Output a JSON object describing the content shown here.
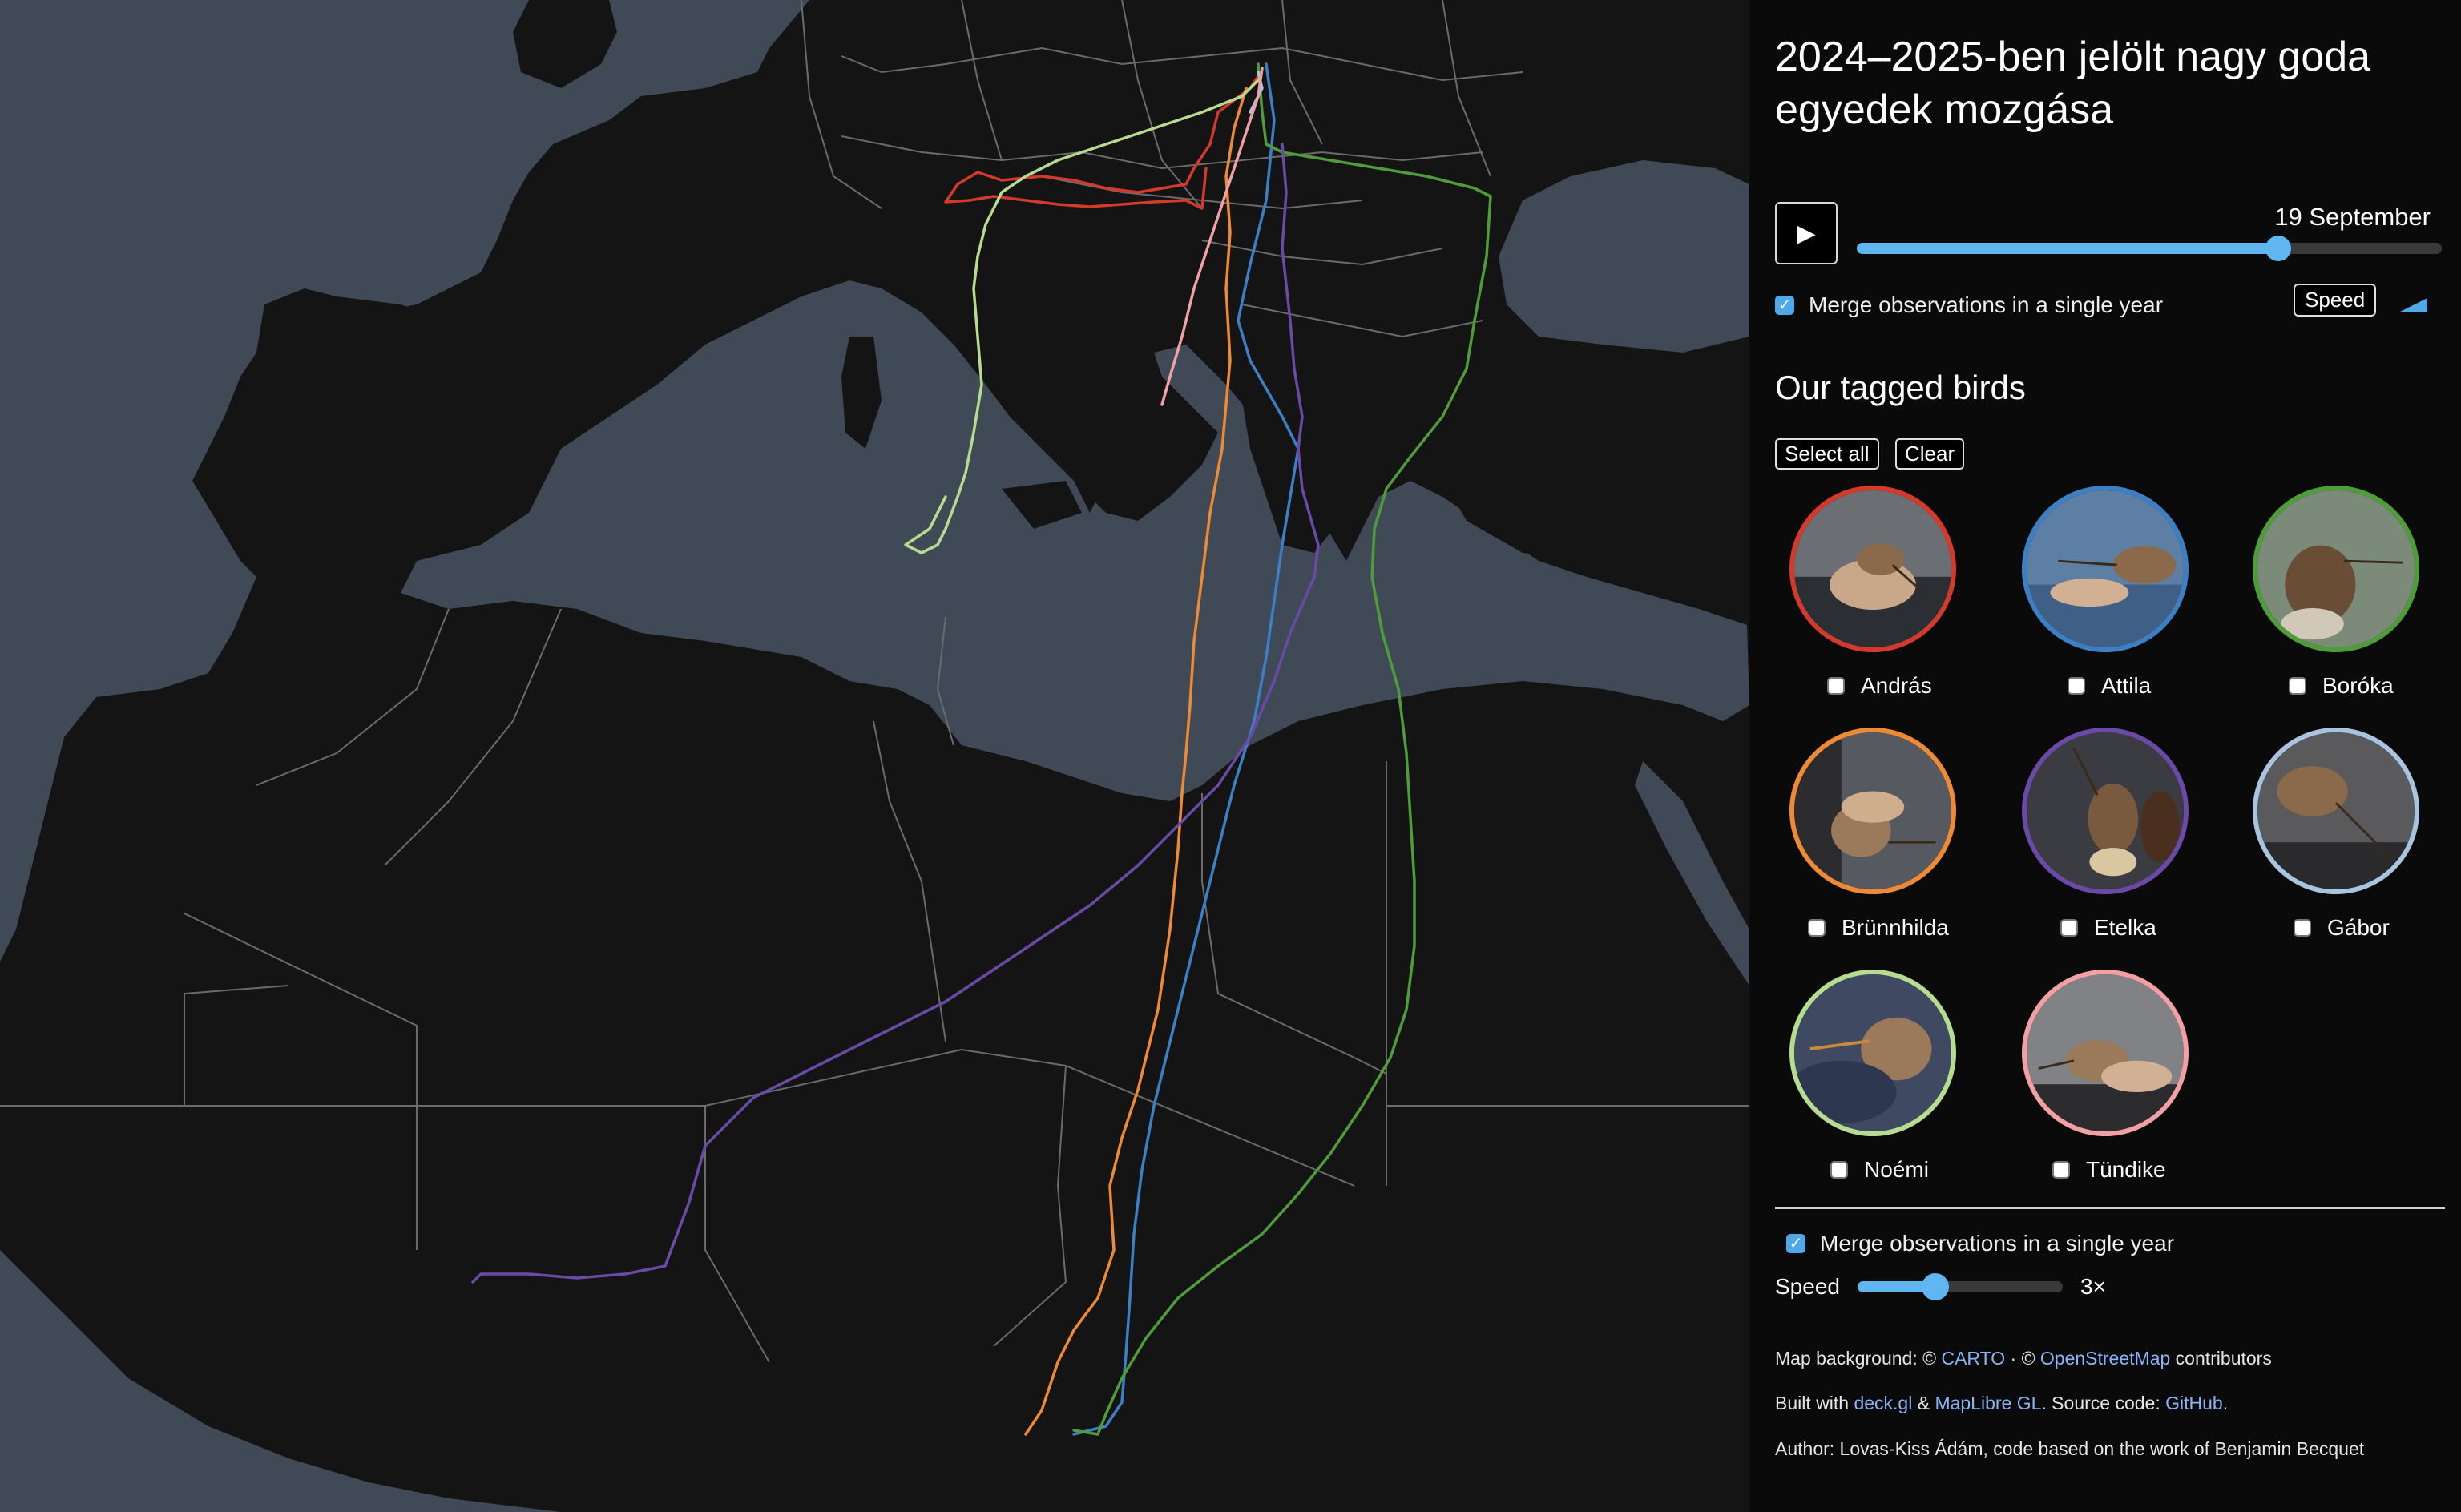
{
  "title": "2024–2025-ben jelölt nagy goda egyedek mozgása",
  "playback": {
    "play_icon": "▶",
    "date": "19 September",
    "timeline_progress": 0.72
  },
  "merge_label": "Merge observations in a single year",
  "speed_pill": "Speed",
  "birds_section": {
    "heading": "Our tagged birds",
    "select_all": "Select all",
    "clear": "Clear",
    "birds": [
      {
        "name": "András",
        "color": "#d33a2c"
      },
      {
        "name": "Attila",
        "color": "#3d7fc4"
      },
      {
        "name": "Boróka",
        "color": "#4f9c3a"
      },
      {
        "name": "Brünnhilda",
        "color": "#ee8a35"
      },
      {
        "name": "Etelka",
        "color": "#6a4aa6"
      },
      {
        "name": "Gábor",
        "color": "#a9c4e0"
      },
      {
        "name": "Noémi",
        "color": "#b5dc8f"
      },
      {
        "name": "Tündike",
        "color": "#f2a0a4"
      }
    ]
  },
  "controls": {
    "merge_label": "Merge observations in a single year",
    "speed_label": "Speed",
    "speed_value": "3×",
    "speed_fraction": 0.38
  },
  "footer": {
    "line1_prefix": "Map background: © ",
    "carto": "CARTO",
    "line1_mid": " · © ",
    "osm": "OpenStreetMap",
    "line1_suffix": " contributors",
    "line2_prefix": "Built with ",
    "deckgl": "deck.gl",
    "line2_amp": " & ",
    "maplibre": "MapLibre GL",
    "line2_mid": ". Source code: ",
    "github": "GitHub",
    "line2_suffix": ".",
    "line3": "Author: Lovas-Kiss Ádám, code based on the work of Benjamin Becquet"
  },
  "map": {
    "land_color": "#141414",
    "water_color": "#404a56",
    "border_color": "#6b6b6b"
  }
}
